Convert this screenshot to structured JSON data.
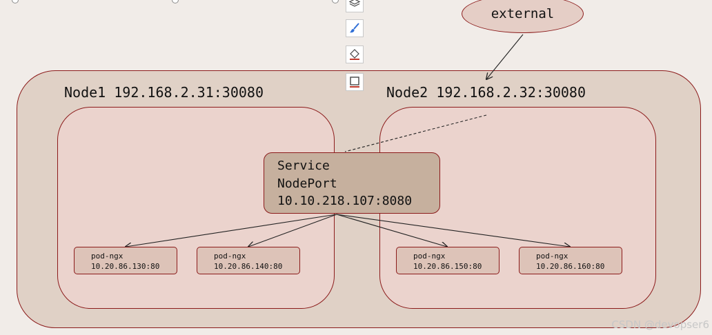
{
  "diagram": {
    "external_label": "external",
    "node1": {
      "title": "Node1 192.168.2.31:30080"
    },
    "node2": {
      "title": "Node2 192.168.2.32:30080"
    },
    "service": {
      "lines": [
        "Service",
        "NodePort",
        "10.10.218.107:8080"
      ]
    },
    "pods": [
      {
        "name": "pod-ngx",
        "address": "10.20.86.130:80"
      },
      {
        "name": "pod-ngx",
        "address": "10.20.86.140:80"
      },
      {
        "name": "pod-ngx",
        "address": "10.20.86.150:80"
      },
      {
        "name": "pod-ngx",
        "address": "10.20.86.160:80"
      }
    ]
  },
  "toolbar": {
    "tools": [
      "layers-icon",
      "brush-icon",
      "fill-bucket-icon",
      "border-color-icon"
    ]
  },
  "watermark": "CSDN @devopser6",
  "colors": {
    "outline": "#8b1a1a",
    "cluster_fill": "#e0d1c6",
    "node_fill": "#ebd3cd",
    "service_fill": "#c6b09e",
    "pod_fill": "#ddc3b8",
    "external_fill": "#e5cec6",
    "background": "#f1ece8"
  }
}
